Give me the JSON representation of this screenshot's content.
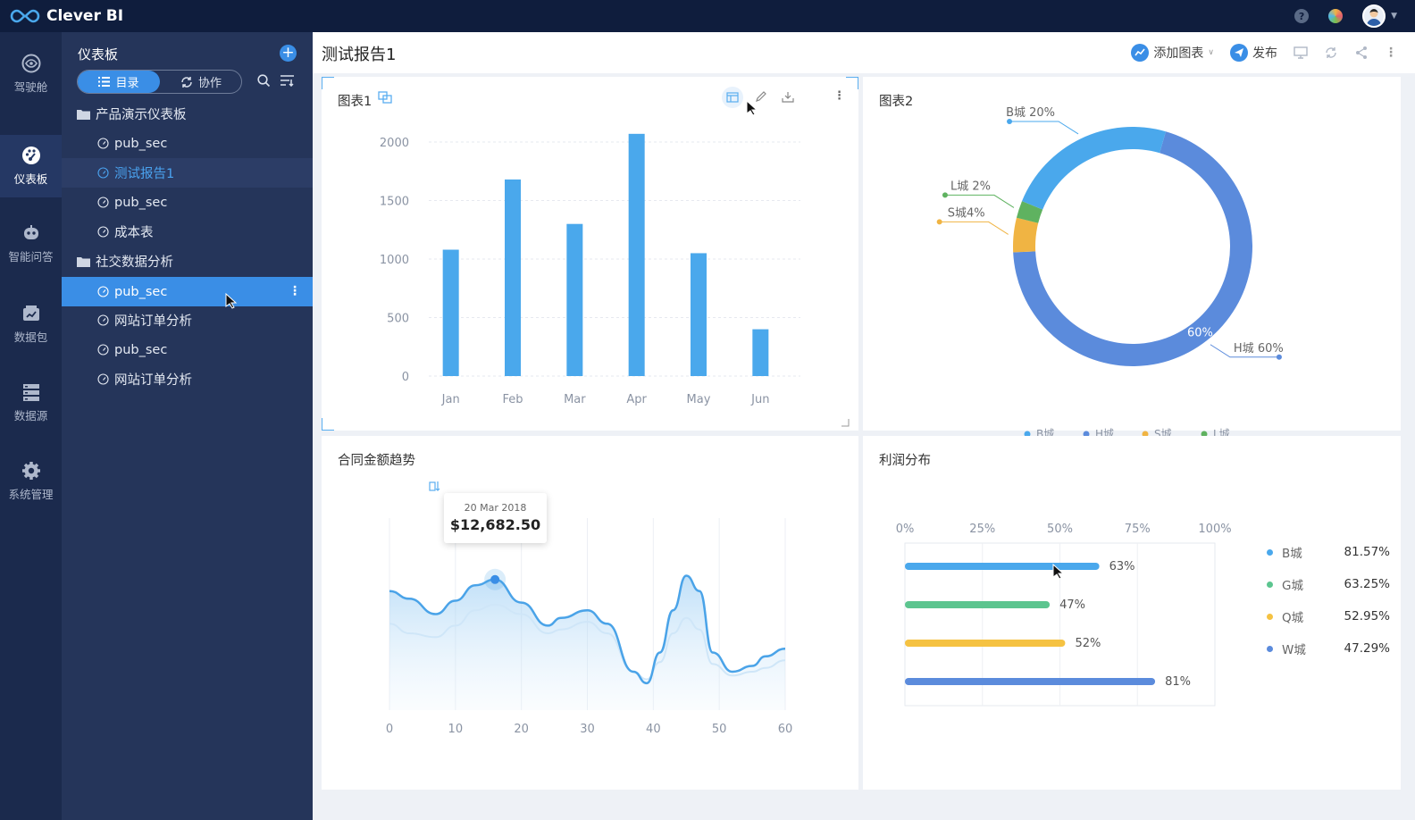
{
  "app": {
    "title": "Clever BI"
  },
  "rail": [
    {
      "label": "驾驶舱",
      "icon": "eye-icon"
    },
    {
      "label": "仪表板",
      "icon": "dashboard-icon"
    },
    {
      "label": "智能问答",
      "icon": "robot-icon"
    },
    {
      "label": "数据包",
      "icon": "data-package-icon"
    },
    {
      "label": "数据源",
      "icon": "database-icon"
    },
    {
      "label": "系统管理",
      "icon": "gear-icon"
    }
  ],
  "sidebar": {
    "title": "仪表板",
    "tabs": [
      {
        "label": "目录"
      },
      {
        "label": "协作"
      }
    ],
    "items": [
      {
        "label": "产品演示仪表板",
        "type": "folder"
      },
      {
        "label": "pub_sec",
        "type": "dashboard"
      },
      {
        "label": "测试报告1",
        "type": "dashboard"
      },
      {
        "label": "pub_sec",
        "type": "dashboard"
      },
      {
        "label": "成本表",
        "type": "dashboard"
      },
      {
        "label": "社交数据分析",
        "type": "folder"
      },
      {
        "label": "pub_sec",
        "type": "dashboard"
      },
      {
        "label": "网站订单分析",
        "type": "dashboard"
      },
      {
        "label": "pub_sec",
        "type": "dashboard"
      },
      {
        "label": "网站订单分析",
        "type": "dashboard"
      }
    ]
  },
  "header": {
    "title": "测试报告1",
    "add_chart": "添加图表",
    "publish": "发布"
  },
  "panels": {
    "chart1": {
      "title": "图表1"
    },
    "chart2": {
      "title": "图表2"
    },
    "chart3": {
      "title": "合同金额趋势"
    },
    "chart4": {
      "title": "利润分布"
    }
  },
  "tooltip": {
    "date": "20 Mar 2018",
    "value": "$12,682.50"
  },
  "colors": {
    "primary": "#3a8ee6",
    "topbar": "#0f1d3d",
    "rail": "#1b2a4d",
    "sidebar": "#25355a"
  },
  "chart_data": [
    {
      "type": "bar",
      "categories": [
        "Jan",
        "Feb",
        "Mar",
        "Apr",
        "May",
        "Jun"
      ],
      "values": [
        1080,
        1680,
        1300,
        2070,
        1050,
        400
      ],
      "yticks": [
        0,
        500,
        1000,
        1500,
        2000
      ],
      "ylim": [
        0,
        2100
      ],
      "color": "#4aa8ec"
    },
    {
      "type": "pie",
      "donut": true,
      "slices": [
        {
          "name": "H城",
          "value": 60,
          "label": "H城 60%",
          "inner_label": "60%",
          "color": "#5b8bdc"
        },
        {
          "name": "S城",
          "value": 4,
          "label": "S城4%",
          "color": "#f0b443"
        },
        {
          "name": "L城",
          "value": 2,
          "label": "L城 2%",
          "color": "#5fb260"
        },
        {
          "name": "B城",
          "value": 20,
          "label": "B城 20%",
          "color": "#4aa8ec"
        }
      ],
      "legend": [
        "B城",
        "H城",
        "S城",
        "L城"
      ]
    },
    {
      "type": "area",
      "x": [
        0,
        3,
        7,
        10,
        13,
        16,
        20,
        24,
        26,
        30,
        33,
        37,
        39,
        41,
        43,
        45,
        47,
        49,
        52,
        55,
        57,
        60
      ],
      "y": [
        0.62,
        0.58,
        0.5,
        0.57,
        0.65,
        0.68,
        0.56,
        0.44,
        0.48,
        0.52,
        0.45,
        0.2,
        0.14,
        0.3,
        0.52,
        0.7,
        0.62,
        0.3,
        0.2,
        0.23,
        0.28,
        0.32
      ],
      "y2": [
        0.45,
        0.4,
        0.38,
        0.44,
        0.52,
        0.55,
        0.5,
        0.4,
        0.42,
        0.46,
        0.4,
        0.2,
        0.16,
        0.25,
        0.4,
        0.48,
        0.42,
        0.24,
        0.18,
        0.2,
        0.22,
        0.26
      ],
      "xticks": [
        0,
        10,
        20,
        30,
        40,
        50,
        60
      ],
      "xlim": [
        0,
        60
      ],
      "highlight_x": 16
    },
    {
      "type": "bar",
      "orientation": "horizontal",
      "categories": [
        "B城",
        "G城",
        "Q城",
        "W城"
      ],
      "values": [
        63,
        47,
        52,
        81
      ],
      "value_labels": [
        "63%",
        "47%",
        "52%",
        "81%"
      ],
      "colors": [
        "#4aa8ec",
        "#5cc58f",
        "#f5c242",
        "#5b8bdc"
      ],
      "xticks": [
        "0%",
        "25%",
        "50%",
        "75%",
        "100%"
      ],
      "xlim": [
        0,
        100
      ],
      "legend": [
        {
          "name": "B城",
          "value": "81.57%",
          "color": "#4aa8ec"
        },
        {
          "name": "G城",
          "value": "63.25%",
          "color": "#5cc58f"
        },
        {
          "name": "Q城",
          "value": "52.95%",
          "color": "#f5c242"
        },
        {
          "name": "W城",
          "value": "47.29%",
          "color": "#5b8bdc"
        }
      ]
    }
  ]
}
